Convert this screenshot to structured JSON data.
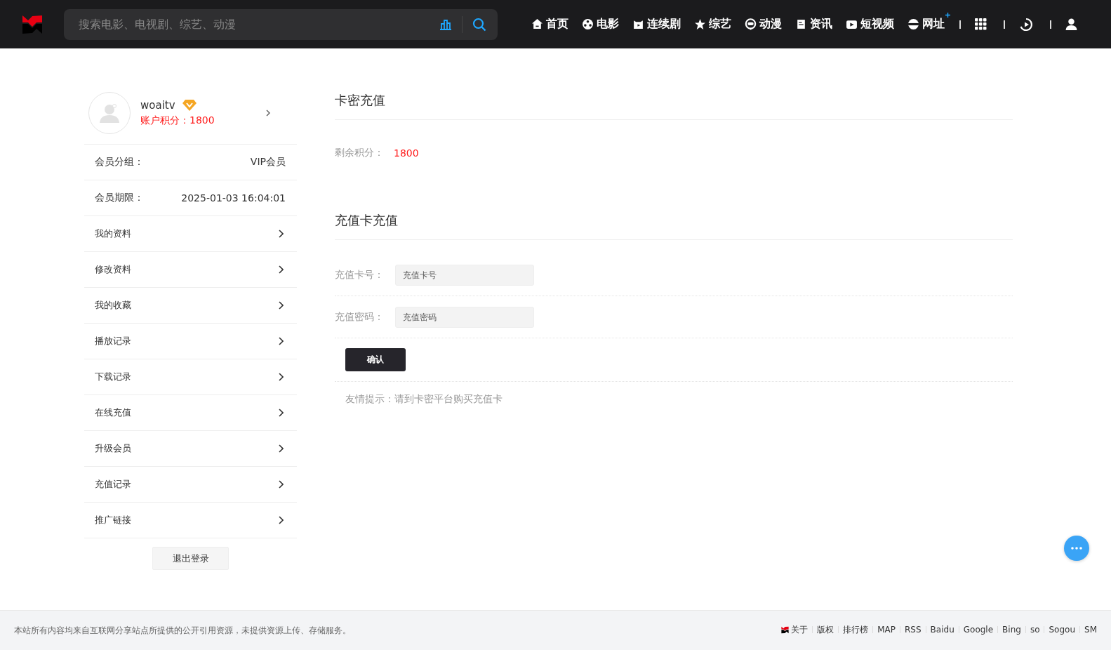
{
  "header": {
    "search": {
      "placeholder": "搜索电影、电视剧、综艺、动漫"
    },
    "nav": [
      {
        "kind": "home",
        "label": "首页"
      },
      {
        "kind": "film",
        "label": "电影"
      },
      {
        "kind": "tv",
        "label": "连续剧"
      },
      {
        "kind": "star",
        "label": "综艺"
      },
      {
        "kind": "anime",
        "label": "动漫"
      },
      {
        "kind": "news",
        "label": "资讯"
      },
      {
        "kind": "video",
        "label": "短视频"
      },
      {
        "kind": "web",
        "label": "网址"
      }
    ]
  },
  "sidebar": {
    "username": "woaitv",
    "points": "账户积分：1800",
    "info": [
      {
        "label": "会员分组：",
        "value": "VIP会员"
      },
      {
        "label": "会员期限：",
        "value": "2025-01-03 16:04:01"
      }
    ],
    "menu": [
      "我的资料",
      "修改资料",
      "我的收藏",
      "播放记录",
      "下载记录",
      "在线充值",
      "升级会员",
      "充值记录",
      "推广链接"
    ],
    "logout": "退出登录"
  },
  "main": {
    "card_section": {
      "title": "卡密充值",
      "points_label": "剩余积分：",
      "points_value": "1800"
    },
    "card_form": {
      "title": "充值卡充值",
      "fields": [
        {
          "label": "充值卡号：",
          "placeholder": "充值卡号"
        },
        {
          "label": "充值密码：",
          "placeholder": "充值密码"
        }
      ],
      "submit": "确认",
      "tip": "友情提示：请到卡密平台购买充值卡"
    }
  },
  "footer": {
    "notice": "本站所有内容均来自互联网分享站点所提供的公开引用资源，未提供资源上传、存储服务。",
    "links": [
      "关于",
      "版权",
      "排行榜",
      "MAP",
      "RSS",
      "Baidu",
      "Google",
      "Bing",
      "so",
      "Sogou",
      "SM"
    ]
  }
}
